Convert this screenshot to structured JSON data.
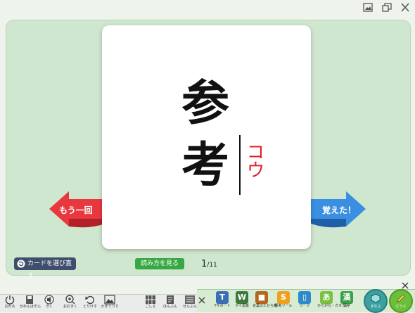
{
  "card": {
    "kanji_top": "参",
    "kanji_bottom": "考",
    "reading": "コウ"
  },
  "nav": {
    "prev_label": "もう一回",
    "next_label": "覚えた！"
  },
  "actions": {
    "choose_card_label": "カードを選び直す",
    "show_reading_label": "読み方を見る"
  },
  "pager": {
    "current": "1",
    "separator": "/",
    "total": "11"
  },
  "toolbar": {
    "items": [
      {
        "label": "おわる",
        "icon": "power-icon"
      },
      {
        "label": "がめんほぞん",
        "icon": "save-icon"
      },
      {
        "label": "きく",
        "icon": "speaker-icon"
      },
      {
        "label": "おおきく",
        "icon": "zoom-icon"
      },
      {
        "label": "とりけす",
        "icon": "undo-icon"
      },
      {
        "label": "かきうつす",
        "icon": "image-icon"
      },
      {
        "label": "ごしえ",
        "icon": "grid-icon"
      },
      {
        "label": "ほんぶん",
        "icon": "page-icon"
      },
      {
        "label": "ぜんぶん",
        "icon": "text-icon"
      }
    ]
  },
  "panel": {
    "items": [
      {
        "label": "Tサポート",
        "icon": "support-icon",
        "color": "#3a6fb5"
      },
      {
        "label": "マイ黒板",
        "icon": "blackboard-icon",
        "color": "#3d7a3d"
      },
      {
        "label": "言葉のたから箱",
        "icon": "treasure-icon",
        "color": "#b5651d"
      },
      {
        "label": "思考ツール",
        "icon": "thinking-icon",
        "color": "#f0a020"
      },
      {
        "label": "ワーク",
        "icon": "work-icon",
        "color": "#2f8ac8"
      },
      {
        "label": "ひらがな・カタカナ",
        "icon": "kana-icon",
        "color": "#7ac142"
      },
      {
        "label": "漢字",
        "icon": "kanji-icon",
        "color": "#3aa04a"
      }
    ],
    "manabi_label": "まなぶ",
    "tools_label": "どうぐ"
  },
  "colors": {
    "stage": "#cfe6cf",
    "reading": "#e02028",
    "prev_arrow": "#e8383d",
    "next_arrow": "#3a8fe0"
  }
}
